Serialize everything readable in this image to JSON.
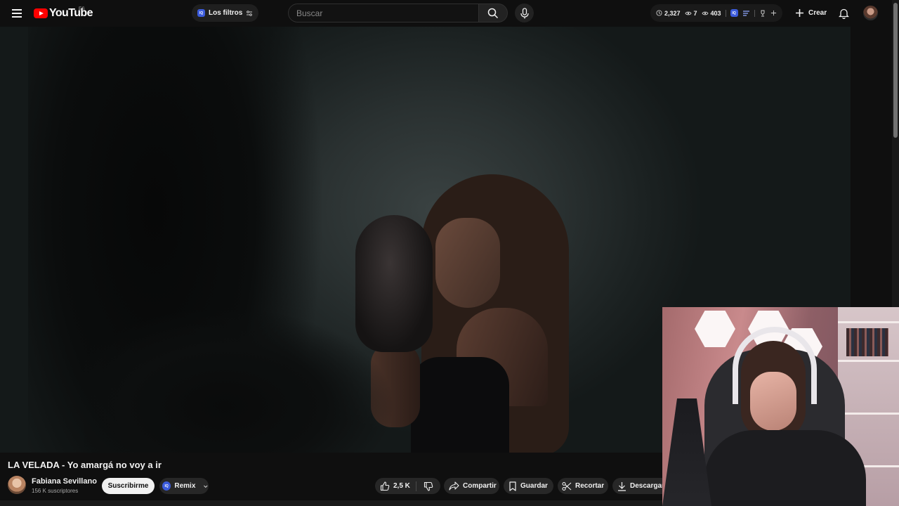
{
  "header": {
    "logo_text": "YouTube",
    "country_code": "ES",
    "filters_label": "Los filtros",
    "search_placeholder": "Buscar",
    "stats": {
      "time_value": "2,327",
      "views_value": "7",
      "watch_value": "403"
    },
    "create_label": "Crear"
  },
  "video": {
    "title": "LA VELADA - Yo amargá no voy a ir"
  },
  "channel": {
    "name": "Fabiana Sevillano",
    "subscribers": "156 K suscriptores",
    "subscribe_label": "Suscribirme",
    "remix_label": "Remix"
  },
  "actions": {
    "like_count": "2,5 K",
    "share_label": "Compartir",
    "save_label": "Guardar",
    "clip_label": "Recortar",
    "download_label": "Descargar"
  },
  "colors": {
    "background": "#0f0f0f",
    "brand_red": "#ff0000",
    "pill_bg": "#272727",
    "subscribe_bg": "#f1f1f1",
    "iq_badge": "#3b5bdb"
  }
}
